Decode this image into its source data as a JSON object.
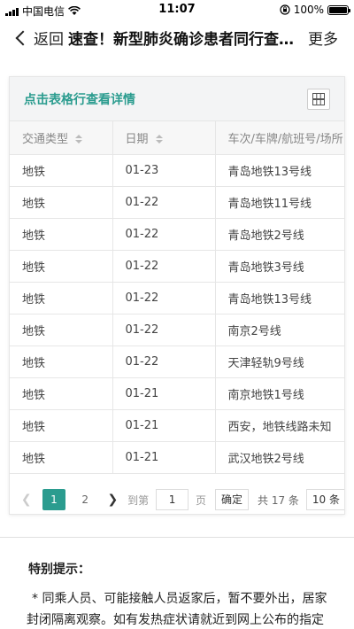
{
  "status_bar": {
    "carrier": "中国电信",
    "time": "11:07",
    "battery": "100%",
    "battery_level": 1.0
  },
  "nav": {
    "back_label": "返回",
    "title": "速查！新型肺炎确诊患者同行查询工具",
    "more_label": "更多"
  },
  "table_card": {
    "hint": "点击表格行查看详情",
    "columns": [
      "交通类型",
      "日期",
      "车次/车牌/航班号/场所"
    ],
    "rows": [
      [
        "地铁",
        "01-23",
        "青岛地铁13号线"
      ],
      [
        "地铁",
        "01-22",
        "青岛地铁11号线"
      ],
      [
        "地铁",
        "01-22",
        "青岛地铁2号线"
      ],
      [
        "地铁",
        "01-22",
        "青岛地铁3号线"
      ],
      [
        "地铁",
        "01-22",
        "青岛地铁13号线"
      ],
      [
        "地铁",
        "01-22",
        "南京2号线"
      ],
      [
        "地铁",
        "01-22",
        "天津轻轨9号线"
      ],
      [
        "地铁",
        "01-21",
        "南京地铁1号线"
      ],
      [
        "地铁",
        "01-21",
        "西安，地铁线路未知"
      ],
      [
        "地铁",
        "01-21",
        "武汉地铁2号线"
      ]
    ]
  },
  "pagination": {
    "pages": [
      "1",
      "2"
    ],
    "current_page": "1",
    "goto_label": "到第",
    "goto_value": "1",
    "page_label": "页",
    "confirm_label": "确定",
    "total": "共 17 条",
    "page_size": "10 条"
  },
  "note": {
    "title": "特别提示：",
    "body": "* 同乘人员、可能接触人员返家后，暂不要外出，居家封闭隔离观察。如有发热症状请就近到网上公布的指定医院发"
  },
  "colors": {
    "accent": "#2b9c8f"
  }
}
